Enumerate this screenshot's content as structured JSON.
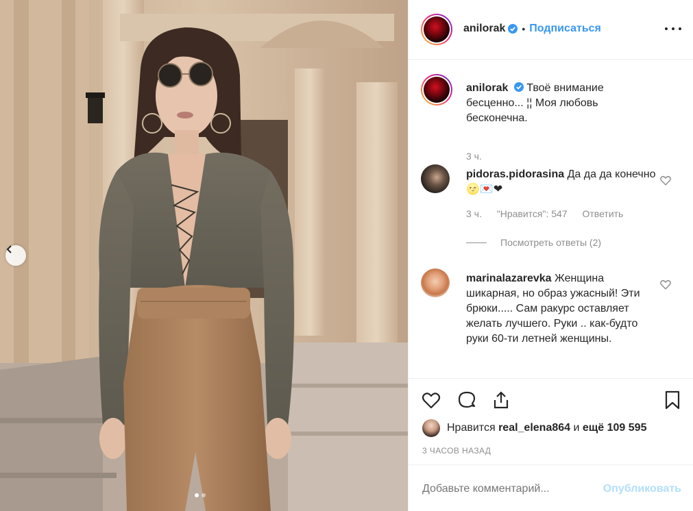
{
  "post": {
    "author": "anilorak",
    "follow_label": "Подписаться",
    "separator": "•",
    "caption": "Твоё внимание бесценно... ¦¦ Моя любовь бесконечна.",
    "caption_time": "3 ч."
  },
  "comments": [
    {
      "user": "pidoras.pidorasina",
      "text": "Да да да конечно🌝💌❤",
      "time": "3 ч.",
      "likes": "\"Нравится\": 547",
      "reply": "Ответить",
      "view_replies": "Посмотреть ответы (2)"
    },
    {
      "user": "marinalazarevka",
      "text": "Женщина шикарная, но образ ужасный! Эти брюки..... Сам ракурс оставляет желать лучшего. Руки .. как-будто руки 60-ти летней женщины."
    }
  ],
  "likes": {
    "prefix": "Нравится",
    "user": "real_elena864",
    "connector": "и",
    "others": "ещё 109 595"
  },
  "timestamp": "3 ЧАСОВ НАЗАД",
  "add_comment": {
    "placeholder": "Добавьте комментарий...",
    "publish": "Опубликовать"
  },
  "icons": {
    "verified": "verified-badge-icon",
    "more": "more-options-icon",
    "like": "heart-icon",
    "comment": "comment-icon",
    "share": "share-icon",
    "save": "bookmark-icon",
    "prev": "chevron-left-icon"
  },
  "colors": {
    "accent": "#3897f0",
    "muted": "#8e8e8e",
    "publish_disabled": "#b2dffc"
  },
  "carousel": {
    "count": 2,
    "active": 1
  }
}
